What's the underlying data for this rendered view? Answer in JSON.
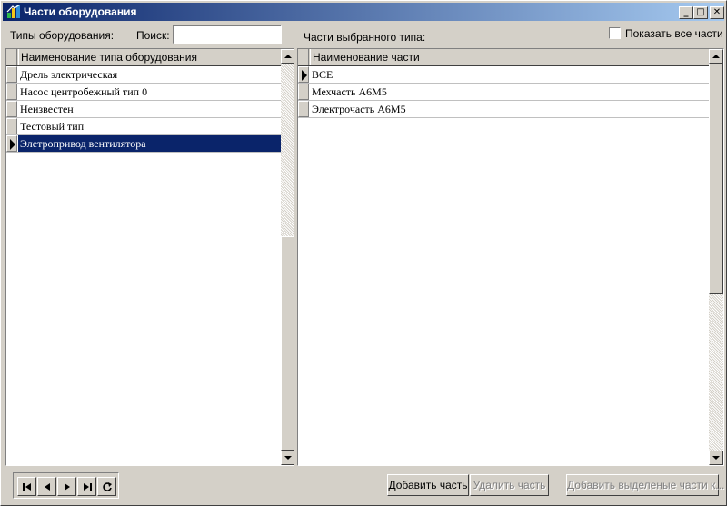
{
  "window": {
    "title": "Части оборудования",
    "controls": {
      "minimize": "_",
      "maximize": "□",
      "close": "✕"
    }
  },
  "left_panel": {
    "types_label": "Типы оборудования:",
    "search_label": "Поиск:",
    "search_value": "",
    "column_header": "Наименование типа оборудования",
    "rows": [
      {
        "name": "Дрель электрическая"
      },
      {
        "name": "Насос центробежный тип 0"
      },
      {
        "name": "Неизвестен"
      },
      {
        "name": "Тестовый тип"
      },
      {
        "name": "Элетропривод вентилятора"
      }
    ],
    "selected_index": 4
  },
  "right_panel": {
    "parts_label": "Части  выбранного типа:",
    "show_all_label": "Показать все части",
    "show_all_checked": false,
    "column_header": "Наименование части",
    "rows": [
      {
        "name": "ВСЕ"
      },
      {
        "name": "Мехчасть А6М5"
      },
      {
        "name": "Электрочасть А6М5"
      }
    ],
    "current_index": 0
  },
  "buttons": {
    "add_part": "Добавить часть",
    "delete_part": "Удалить часть",
    "add_selected_parts": "Добавить выделеные части к..."
  },
  "icons": {
    "title": "app-equipment-icon",
    "nav_first": "first-record-icon",
    "nav_prev": "prev-record-icon",
    "nav_next": "next-record-icon",
    "nav_last": "last-record-icon",
    "nav_refresh": "refresh-icon"
  },
  "colors": {
    "title_bar_start": "#0a246a",
    "title_bar_end": "#a6caf0",
    "selection": "#0a246a",
    "face": "#d4d0c8"
  }
}
